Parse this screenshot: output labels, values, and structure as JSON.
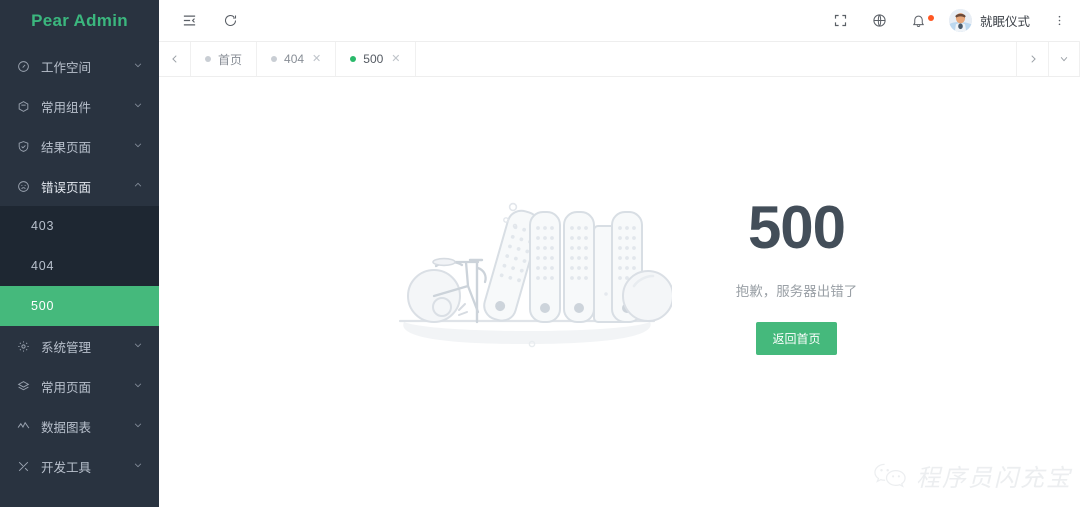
{
  "sidebar": {
    "logo": "Pear Admin",
    "logo_color": "#3bb77e",
    "bg_color": "#293340",
    "active_color": "#45b97c",
    "items": [
      {
        "label": "工作空间",
        "icon": "dashboard-icon",
        "arrow": "chevron-down-icon",
        "expanded": false
      },
      {
        "label": "常用组件",
        "icon": "component-icon",
        "arrow": "chevron-down-icon",
        "expanded": false
      },
      {
        "label": "结果页面",
        "icon": "check-circle-icon",
        "arrow": "chevron-down-icon",
        "expanded": false
      },
      {
        "label": "错误页面",
        "icon": "sad-face-icon",
        "arrow": "chevron-up-icon",
        "expanded": true
      },
      {
        "label": "系统管理",
        "icon": "gear-icon",
        "arrow": "chevron-down-icon",
        "expanded": false
      },
      {
        "label": "常用页面",
        "icon": "layers-icon",
        "arrow": "chevron-down-icon",
        "expanded": false
      },
      {
        "label": "数据图表",
        "icon": "chart-line-icon",
        "arrow": "chevron-down-icon",
        "expanded": false
      },
      {
        "label": "开发工具",
        "icon": "tools-icon",
        "arrow": "chevron-down-icon",
        "expanded": false
      }
    ],
    "submenu": [
      {
        "label": "403",
        "active": false
      },
      {
        "label": "404",
        "active": false
      },
      {
        "label": "500",
        "active": true
      }
    ]
  },
  "topbar": {
    "menu_fold_icon": "menu-fold-icon",
    "refresh_icon": "refresh-icon",
    "fullscreen_icon": "fullscreen-icon",
    "theme_icon": "globe-icon",
    "bell_icon": "bell-icon",
    "has_notification": true,
    "user_name": "就眠仪式",
    "more_icon": "more-vertical-icon"
  },
  "tabbar": {
    "prev_icon": "chevron-left-icon",
    "next_icon": "chevron-right-icon",
    "dropdown_icon": "chevron-down-icon",
    "tabs": [
      {
        "label": "首页",
        "active": false,
        "closable": false
      },
      {
        "label": "404",
        "active": false,
        "closable": true
      },
      {
        "label": "500",
        "active": true,
        "closable": true
      }
    ],
    "close_glyph": "✕"
  },
  "content": {
    "error_code": "500",
    "error_desc": "抱歉，服务器出错了",
    "button_label": "返回首页",
    "button_color": "#45b97c",
    "code_color": "#434e59",
    "illustration": "server-bicycle-illustration"
  },
  "watermark": {
    "icon": "wechat-icon",
    "text": "程序员闪充宝"
  }
}
